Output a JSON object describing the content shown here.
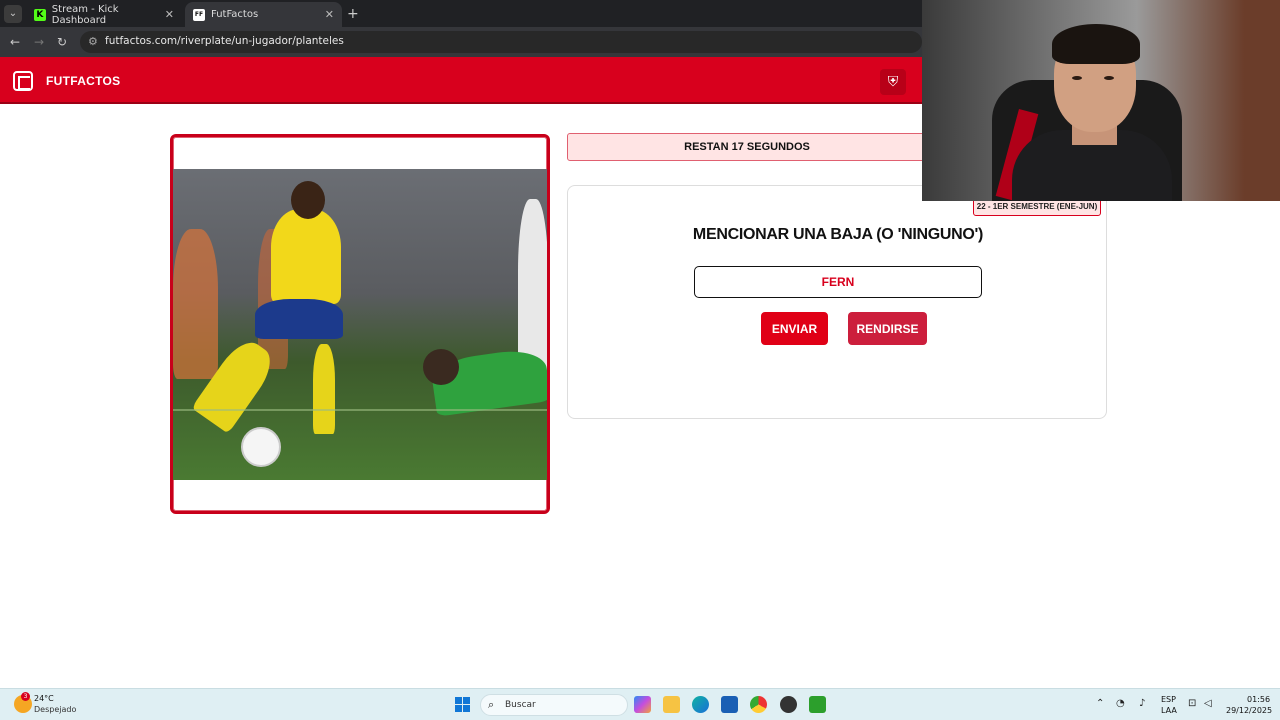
{
  "browser": {
    "tabs": [
      {
        "title": "Stream - Kick Dashboard",
        "favicon": "K",
        "active": false
      },
      {
        "title": "FutFactos",
        "favicon": "FF",
        "active": true
      }
    ],
    "new_tab_label": "+",
    "url": "futfactos.com/riverplate/un-jugador/planteles"
  },
  "site": {
    "title": "FUTFACTOS",
    "accent_color": "#d8001d"
  },
  "game": {
    "timer_text": "RESTAN 17 SEGUNDOS",
    "semester_tag": "22 - 1ER SEMESTRE (ENE-JUN)",
    "question": "MENCIONAR UNA BAJA (O 'NINGUNO')",
    "answer_value": "FERN",
    "send_label": "ENVIAR",
    "give_up_label": "RENDIRSE"
  },
  "taskbar": {
    "weather_temp": "24°C",
    "weather_desc": "Despejado",
    "weather_badge": "3",
    "search_placeholder": "Buscar",
    "lang_top": "ESP",
    "lang_bottom": "LAA",
    "time": "01:56",
    "date": "29/12/2025"
  }
}
